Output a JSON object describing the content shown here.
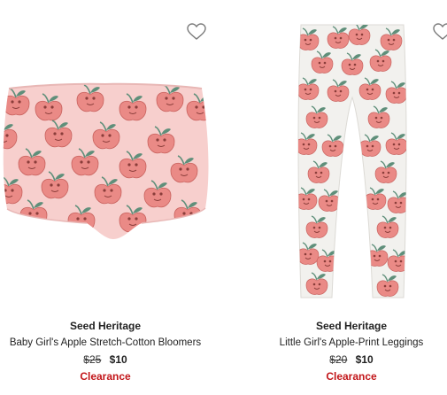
{
  "products": [
    {
      "brand": "Seed Heritage",
      "name": "Baby Girl's Apple Stretch-Cotton Bloomers",
      "original_price": "$25",
      "sale_price": "$10",
      "badge": "Clearance"
    },
    {
      "brand": "Seed Heritage",
      "name": "Little Girl's Apple-Print Leggings",
      "original_price": "$20",
      "sale_price": "$10",
      "badge": "Clearance"
    }
  ],
  "colors": {
    "bloomers_fabric": "#f7cfcd",
    "leggings_fabric": "#f2f1ee",
    "apple": "#ea8a86",
    "leaf": "#5f8f7a",
    "clearance": "#c2161a"
  },
  "icons": {
    "wishlist": "heart-outline-icon"
  }
}
